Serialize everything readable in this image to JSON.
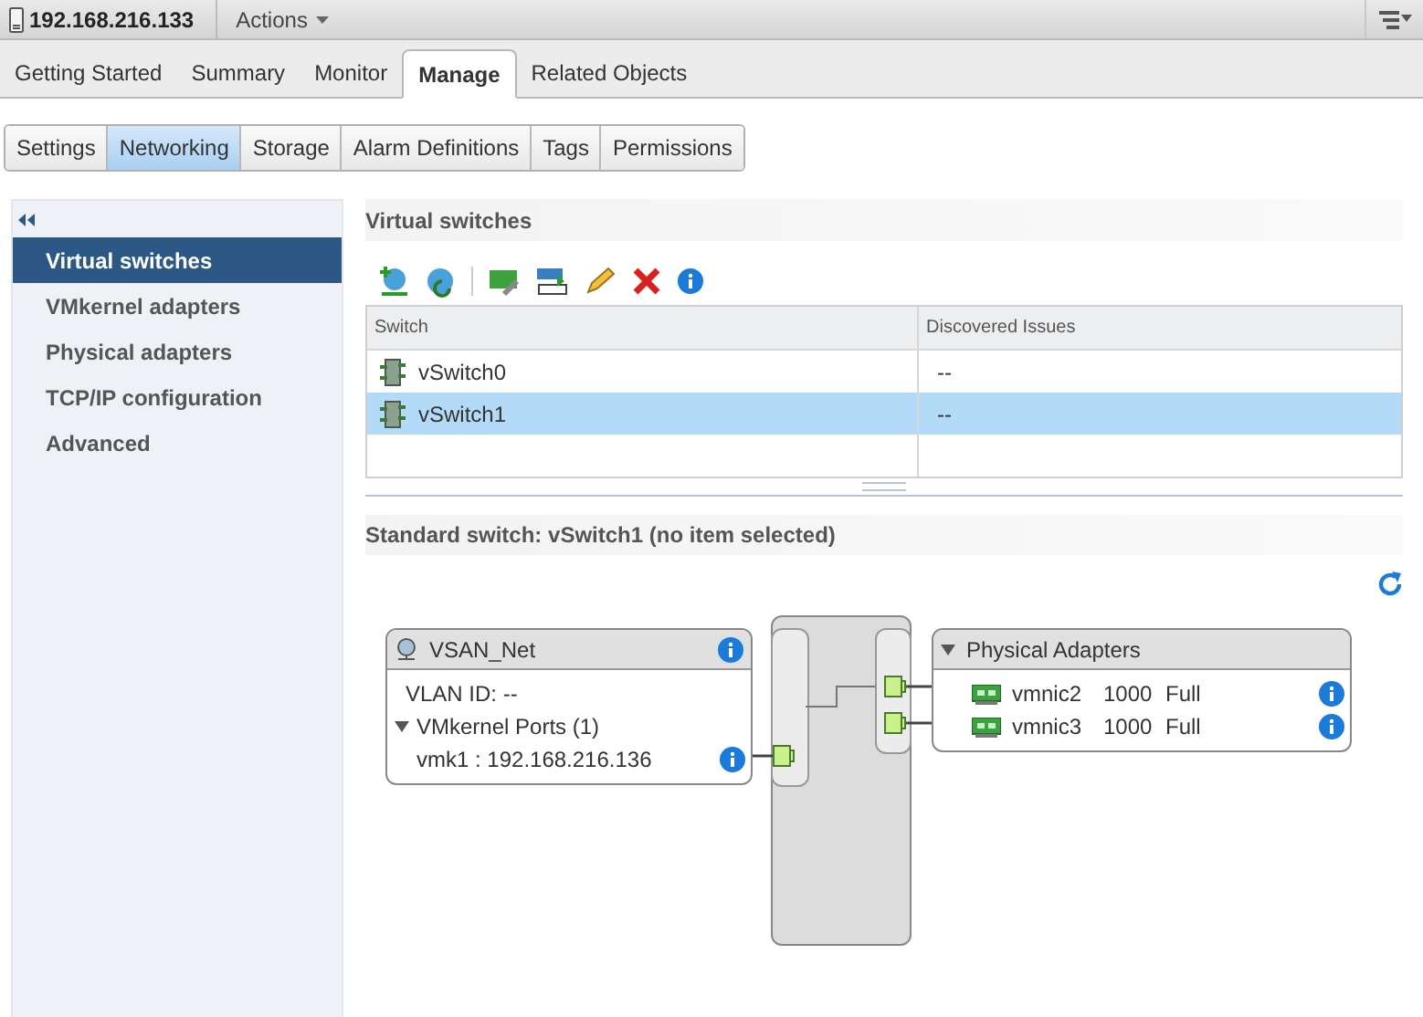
{
  "header": {
    "title": "192.168.216.133",
    "actions": "Actions"
  },
  "tabs": [
    {
      "label": "Getting Started",
      "selected": false
    },
    {
      "label": "Summary",
      "selected": false
    },
    {
      "label": "Monitor",
      "selected": false
    },
    {
      "label": "Manage",
      "selected": true
    },
    {
      "label": "Related Objects",
      "selected": false
    }
  ],
  "subtabs": [
    {
      "label": "Settings",
      "selected": false
    },
    {
      "label": "Networking",
      "selected": true
    },
    {
      "label": "Storage",
      "selected": false
    },
    {
      "label": "Alarm Definitions",
      "selected": false
    },
    {
      "label": "Tags",
      "selected": false
    },
    {
      "label": "Permissions",
      "selected": false
    }
  ],
  "sidebar": {
    "items": [
      {
        "label": "Virtual switches",
        "selected": true
      },
      {
        "label": "VMkernel adapters",
        "selected": false
      },
      {
        "label": "Physical adapters",
        "selected": false
      },
      {
        "label": "TCP/IP configuration",
        "selected": false
      },
      {
        "label": "Advanced",
        "selected": false
      }
    ]
  },
  "section_title": "Virtual switches",
  "table": {
    "columns": [
      "Switch",
      "Discovered Issues"
    ],
    "rows": [
      {
        "cells": [
          "vSwitch0",
          "--"
        ],
        "selected": false
      },
      {
        "cells": [
          "vSwitch1",
          "--"
        ],
        "selected": true
      }
    ]
  },
  "detail_title": "Standard switch: vSwitch1 (no item selected)",
  "diagram": {
    "port_group": {
      "name": "VSAN_Net",
      "vlan": "VLAN ID: --",
      "ports_label": "VMkernel Ports (1)",
      "expanded": true,
      "ports": [
        "vmk1 : 192.168.216.136"
      ]
    },
    "adapters": {
      "title": "Physical Adapters",
      "expanded": true,
      "items": [
        {
          "name": "vmnic2",
          "speed": "1000",
          "duplex": "Full"
        },
        {
          "name": "vmnic3",
          "speed": "1000",
          "duplex": "Full"
        }
      ]
    }
  }
}
